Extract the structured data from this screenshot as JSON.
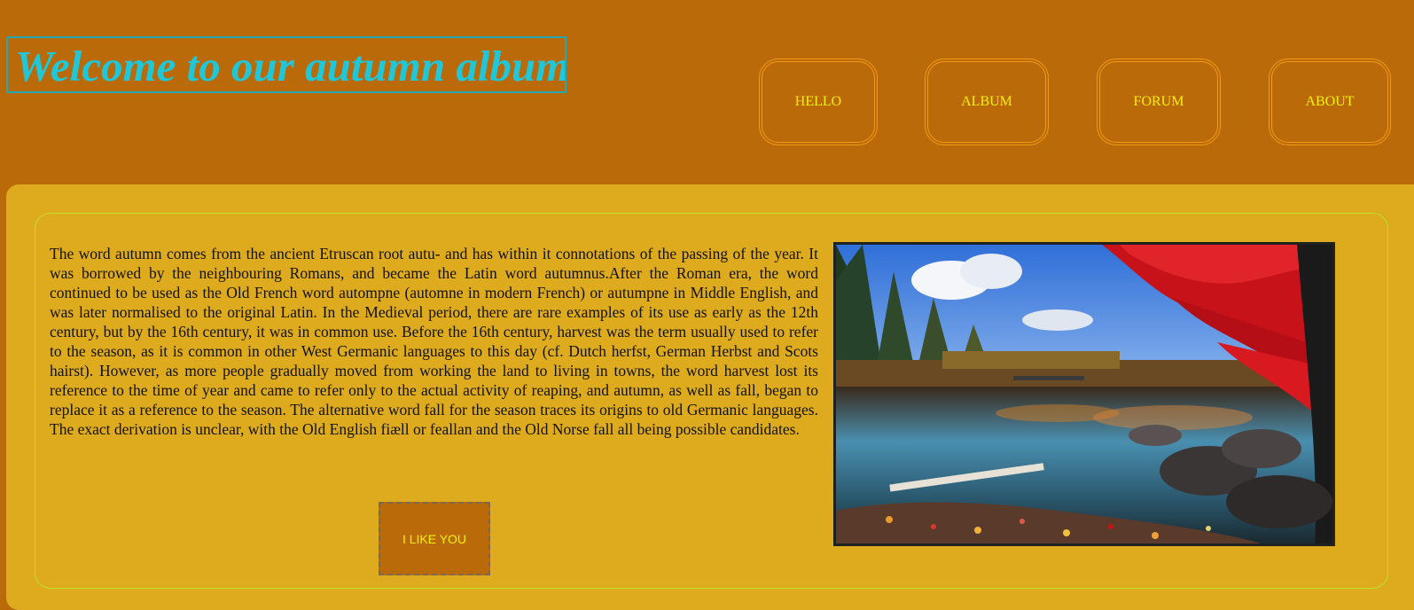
{
  "header": {
    "title": "Welcome to our autumn album"
  },
  "nav": {
    "items": [
      {
        "label": "HELLO"
      },
      {
        "label": "ALBUM"
      },
      {
        "label": "FORUM"
      },
      {
        "label": "ABOUT"
      }
    ]
  },
  "main": {
    "article": "The word autumn comes from the ancient Etruscan root autu- and has within it connotations of the passing of the year. It was borrowed by the neighbouring Romans, and became the Latin word autumnus.After the Roman era, the word continued to be used as the Old French word autompne (automne in modern French) or autumpne in Middle English, and was later normalised to the original Latin. In the Medieval period, there are rare examples of its use as early as the 12th century, but by the 16th century, it was in common use. Before the 16th century, harvest was the term usually used to refer to the season, as it is common in other West Germanic languages to this day (cf. Dutch herfst, German Herbst and Scots hairst). However, as more people gradually moved from working the land to living in towns, the word harvest lost its reference to the time of year and came to refer only to the actual activity of reaping, and autumn, as well as fall, began to replace it as a reference to the season. The alternative word fall for the season traces its origins to old Germanic languages. The exact derivation is unclear, with the Old English fiæll or feallan and the Old Norse fall all being possible candidates.",
    "like_button": "I LIKE YOU"
  },
  "colors": {
    "page_bg": "#bb6a09",
    "panel_bg": "#deab1e",
    "title_text": "#1fc7d8",
    "nav_text": "#f3f200",
    "nav_border": "#f39a14"
  }
}
